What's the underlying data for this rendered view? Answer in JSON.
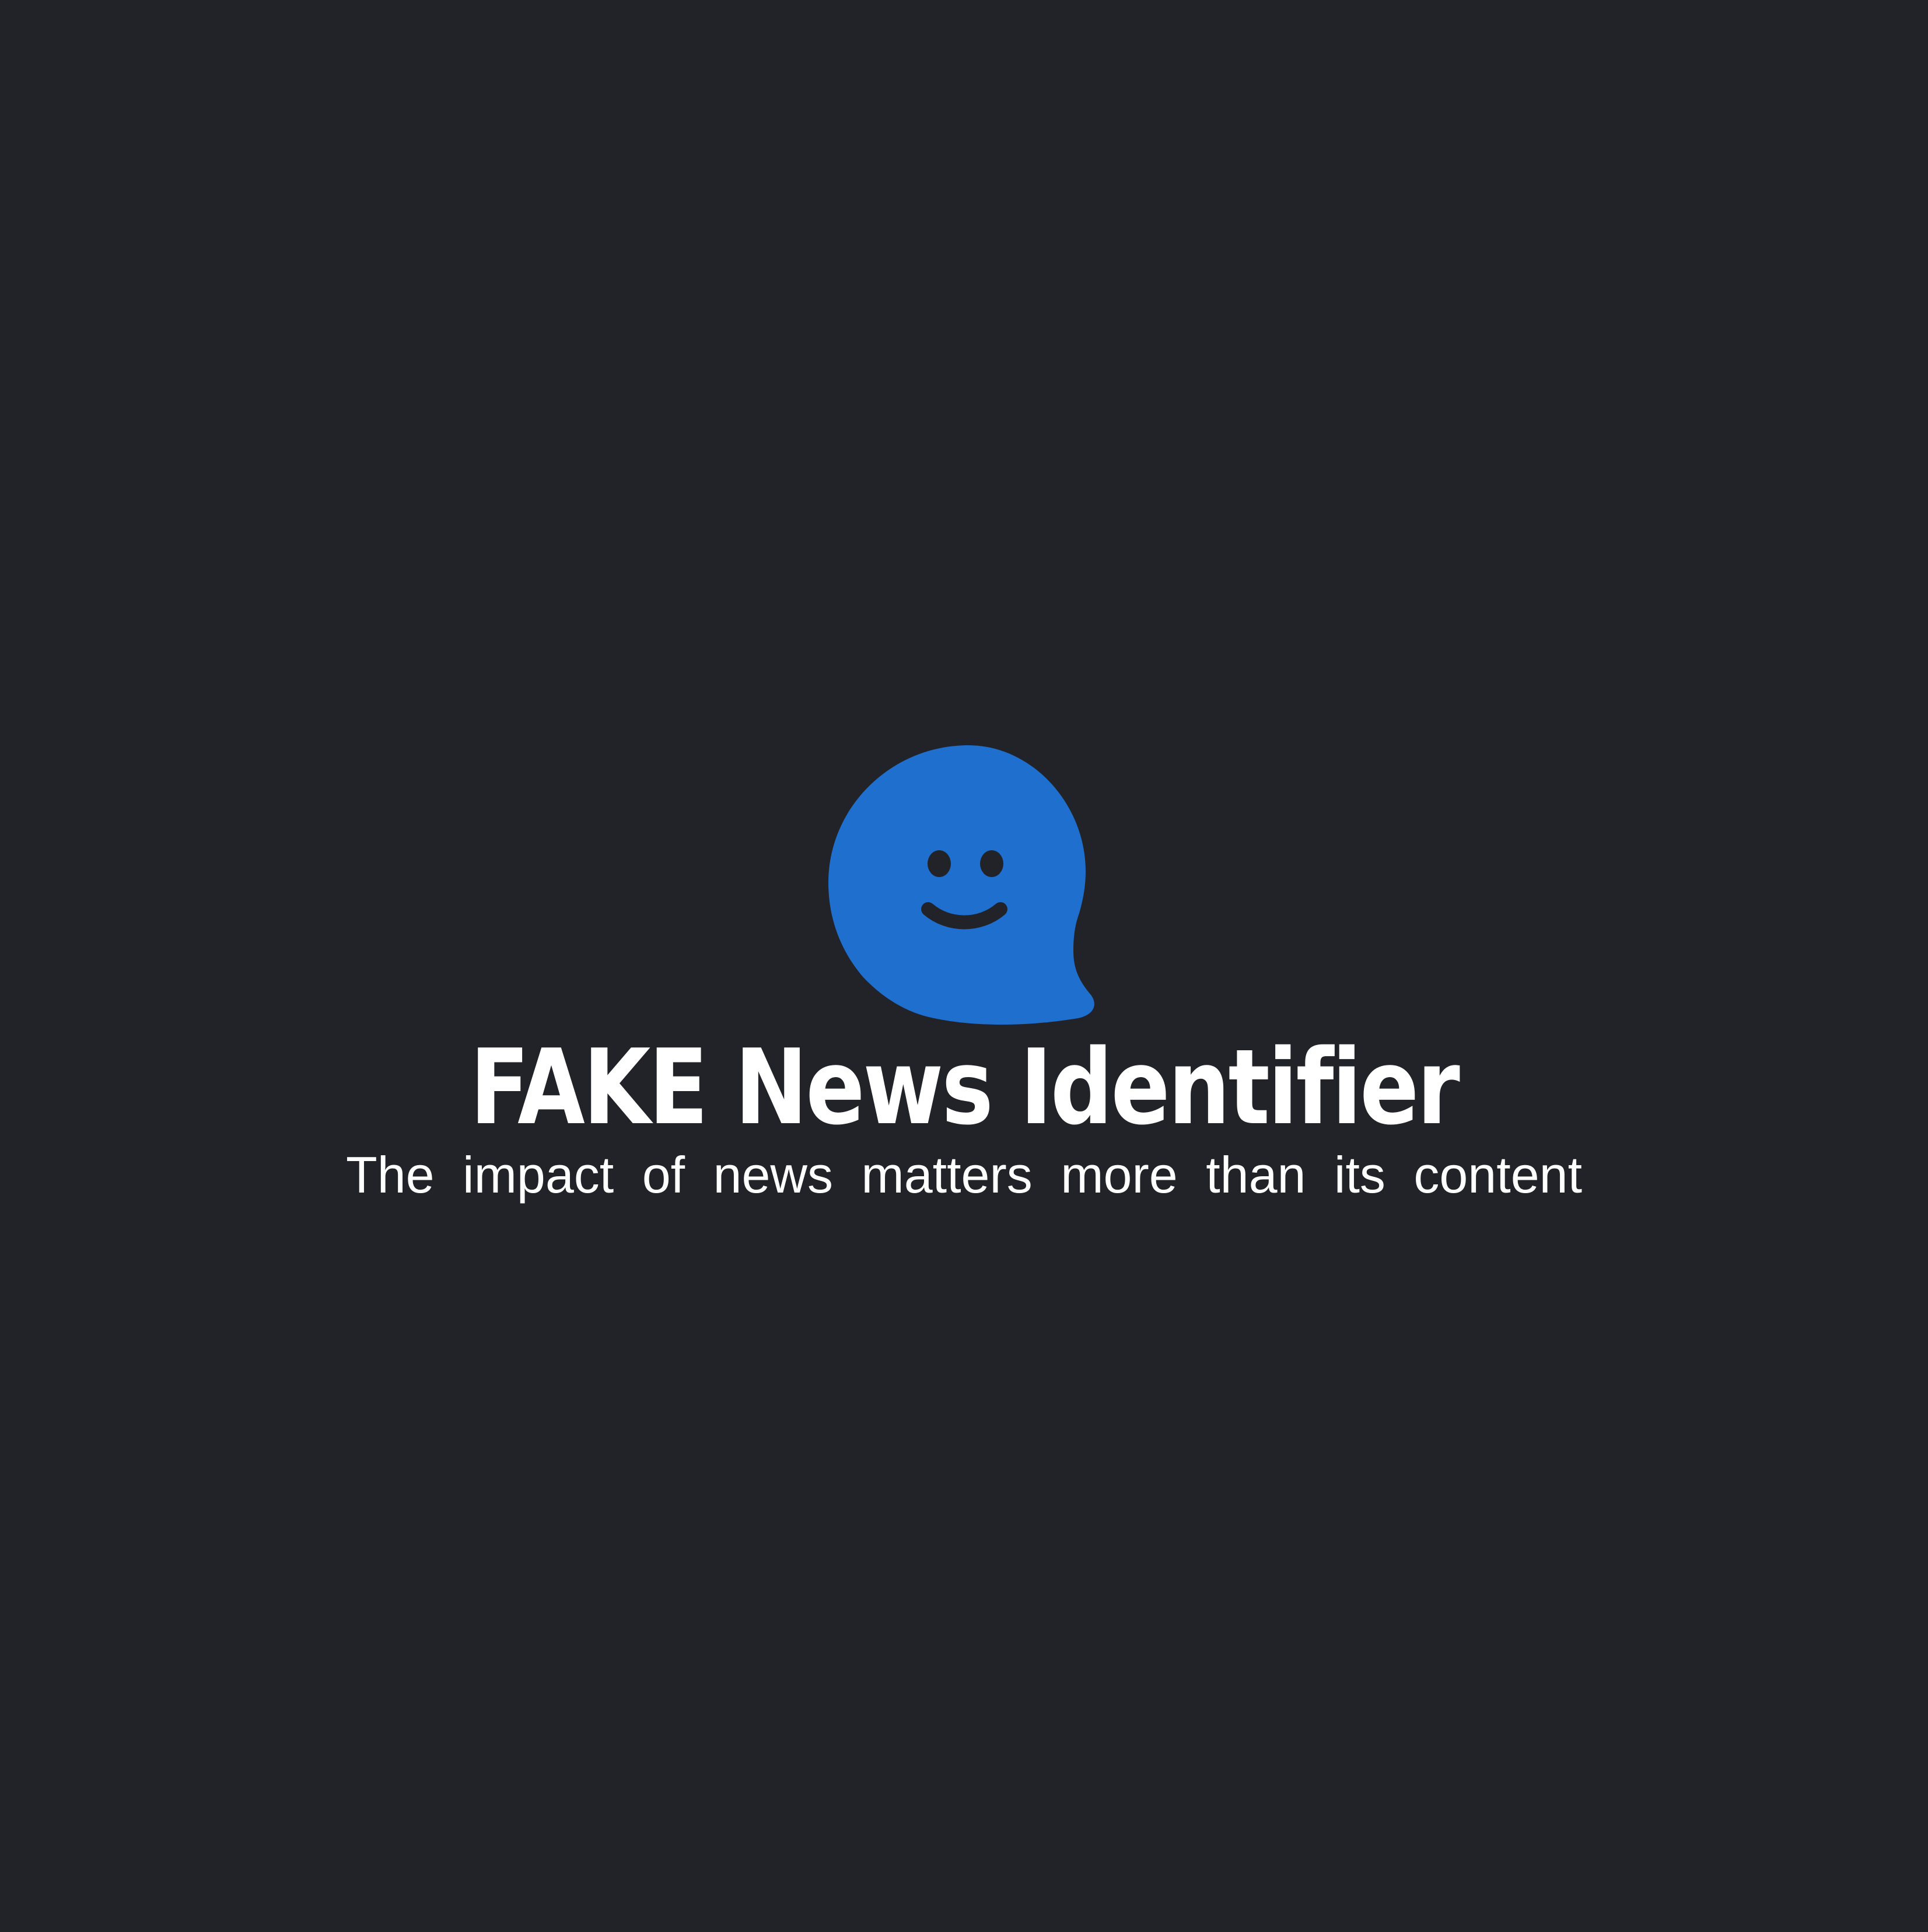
{
  "brand": {
    "title": "FAKE News Identifier",
    "tagline": "The impact of news matters more than its content",
    "logo_icon": "smiling-speech-bubble-icon",
    "colors": {
      "background": "#212329",
      "bubble": "#1F6FCF",
      "text": "#FFFFFF"
    }
  }
}
